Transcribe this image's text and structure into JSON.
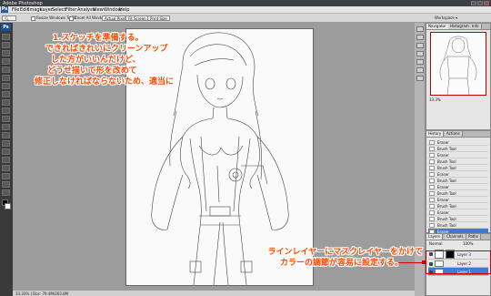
{
  "window": {
    "title": "Adobe Photoshop"
  },
  "menu": {
    "app_badge": "Ps",
    "items": [
      "File",
      "Edit",
      "Image",
      "Layer",
      "Select",
      "Filter",
      "Analysis",
      "View",
      "Window",
      "Help"
    ]
  },
  "options": {
    "resize_windows": "Resize Windows To Fit",
    "zoom_all": "Zoom All Windows",
    "actual_pixels": "Actual Pixels",
    "fit_screen": "Fit Screen",
    "print_size": "Print Size",
    "workspace": "Workspace ▾"
  },
  "navigator": {
    "tabs": [
      "Navigator",
      "Histogram",
      "Info"
    ],
    "zoom": "33.3%"
  },
  "history": {
    "tabs": [
      "History",
      "Actions"
    ],
    "rows": [
      "Eraser",
      "Brush Tool",
      "Eraser",
      "Brush Tool",
      "Brush Tool",
      "Eraser",
      "Brush Tool",
      "Eraser",
      "Brush Tool",
      "Eraser",
      "Brush Tool",
      "Eraser",
      "Brush Tool",
      "Brush Tool",
      "Eraser"
    ],
    "selected_index": 14
  },
  "layers": {
    "tabs": [
      "Layers",
      "Channels",
      "Paths"
    ],
    "blend_mode": "Normal",
    "opacity": "100%",
    "rows": [
      {
        "name": "Layer 3",
        "has_mask": true
      },
      {
        "name": "Layer 2",
        "has_mask": false
      },
      {
        "name": "Layer 1",
        "has_mask": false
      }
    ],
    "selected_index": 2
  },
  "status": {
    "doc": "33.33% | Doc: 79.4M/263.8M"
  },
  "annotations": {
    "top_lines": [
      "1.スケッチを準備する。",
      "できればきれいにクリーンアップ",
      "した方がいいんだけど、",
      "どうせ描いて形を改めて",
      "修正しなければならないため、適当に"
    ],
    "bottom_lines": [
      "ラインレイヤーにマスクレイヤーをかけて",
      "カラーの調節が容易に設定する。"
    ]
  },
  "colors": {
    "annotation": "#ff4a00",
    "selection": "#3a7bd5",
    "highlight": "#d50000"
  }
}
